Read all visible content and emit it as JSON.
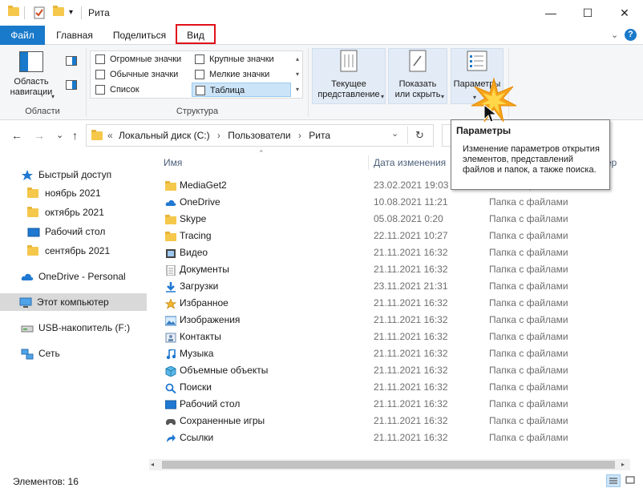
{
  "window": {
    "title": "Рита",
    "minimize_glyph": "—",
    "maximize_glyph": "☐",
    "close_glyph": "✕"
  },
  "ribbon_tabs": [
    "Файл",
    "Главная",
    "Поделиться",
    "Вид"
  ],
  "ribbon": {
    "areas": {
      "nav_pane_label_1": "Область",
      "nav_pane_label_2": "навигации",
      "group_label": "Области"
    },
    "structure": {
      "items": [
        "Огромные значки",
        "Обычные значки",
        "Список",
        "Крупные значки",
        "Мелкие значки",
        "Таблица"
      ],
      "selected": "Таблица",
      "group_label": "Структура"
    },
    "current_view_1": "Текущее",
    "current_view_2": "представление",
    "show_hide_1": "Показать",
    "show_hide_2": "или скрыть",
    "options_label": "Параметры"
  },
  "navigation": {
    "back": "←",
    "forward": "→",
    "down": "⌄",
    "up": "↑",
    "breadcrumb": [
      "Локальный диск (C:)",
      "Пользователи",
      "Рита"
    ],
    "refresh": "↻"
  },
  "tooltip": {
    "title": "Параметры",
    "body": "Изменение параметров открытия элементов, представлений файлов и папок, а также поиска."
  },
  "sidebar": {
    "items": [
      {
        "label": "Быстрый доступ",
        "icon": "star-icon"
      },
      {
        "label": "ноябрь 2021",
        "icon": "folder-icon"
      },
      {
        "label": "октябрь 2021",
        "icon": "folder-icon"
      },
      {
        "label": "Рабочий стол",
        "icon": "desktop-icon"
      },
      {
        "label": "сентябрь 2021",
        "icon": "folder-icon"
      },
      {
        "label": "OneDrive - Personal",
        "icon": "cloud-icon"
      },
      {
        "label": "Этот компьютер",
        "icon": "computer-icon"
      },
      {
        "label": "USB-накопитель (F:)",
        "icon": "drive-icon"
      },
      {
        "label": "Сеть",
        "icon": "network-icon"
      }
    ]
  },
  "file_list": {
    "columns": [
      "Имя",
      "Дата изменения",
      "Тип",
      "Размер"
    ],
    "visible_column_fragment": "ер",
    "rows": [
      {
        "name": "MediaGet2",
        "date": "23.02.2021 19:03",
        "type": "Папка с файлами",
        "icon": "folder-icon"
      },
      {
        "name": "OneDrive",
        "date": "10.08.2021 11:21",
        "type": "Папка с файлами",
        "icon": "cloud-icon"
      },
      {
        "name": "Skype",
        "date": "05.08.2021 0:20",
        "type": "Папка с файлами",
        "icon": "folder-icon"
      },
      {
        "name": "Tracing",
        "date": "22.11.2021 10:27",
        "type": "Папка с файлами",
        "icon": "folder-icon"
      },
      {
        "name": "Видео",
        "date": "21.11.2021 16:32",
        "type": "Папка с файлами",
        "icon": "video-icon"
      },
      {
        "name": "Документы",
        "date": "21.11.2021 16:32",
        "type": "Папка с файлами",
        "icon": "documents-icon"
      },
      {
        "name": "Загрузки",
        "date": "23.11.2021 21:31",
        "type": "Папка с файлами",
        "icon": "download-icon"
      },
      {
        "name": "Избранное",
        "date": "21.11.2021 16:32",
        "type": "Папка с файлами",
        "icon": "star-icon"
      },
      {
        "name": "Изображения",
        "date": "21.11.2021 16:32",
        "type": "Папка с файлами",
        "icon": "pictures-icon"
      },
      {
        "name": "Контакты",
        "date": "21.11.2021 16:32",
        "type": "Папка с файлами",
        "icon": "contacts-icon"
      },
      {
        "name": "Музыка",
        "date": "21.11.2021 16:32",
        "type": "Папка с файлами",
        "icon": "music-icon"
      },
      {
        "name": "Объемные объекты",
        "date": "21.11.2021 16:32",
        "type": "Папка с файлами",
        "icon": "3d-objects-icon"
      },
      {
        "name": "Поиски",
        "date": "21.11.2021 16:32",
        "type": "Папка с файлами",
        "icon": "search-icon"
      },
      {
        "name": "Рабочий стол",
        "date": "21.11.2021 16:32",
        "type": "Папка с файлами",
        "icon": "desktop-icon"
      },
      {
        "name": "Сохраненные игры",
        "date": "21.11.2021 16:32",
        "type": "Папка с файлами",
        "icon": "games-icon"
      },
      {
        "name": "Ссылки",
        "date": "21.11.2021 16:32",
        "type": "Папка с файлами",
        "icon": "links-icon"
      }
    ]
  },
  "status_bar": {
    "item_count": "Элементов: 16"
  },
  "colors": {
    "accent": "#1979ca",
    "highlight_box": "#e0111a",
    "selected_bg": "#cce4f7",
    "folder": "#f5c84c"
  }
}
